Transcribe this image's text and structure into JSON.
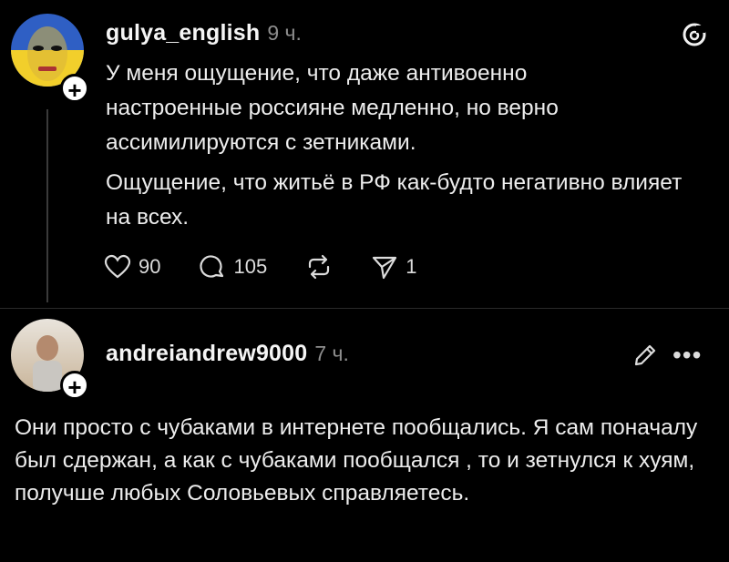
{
  "post1": {
    "username": "gulya_english",
    "time": "9 ч.",
    "paragraphs": [
      "У меня ощущение, что даже антивоенно настроенные россияне медленно, но верно ассимилируются с зетниками.",
      "Ощущение, что житьё в РФ как-будто негативно влияет на всех."
    ],
    "likes": "90",
    "replies": "105",
    "shares": "1"
  },
  "post2": {
    "username": "andreiandrew9000",
    "time": "7 ч.",
    "text": "Они просто с чубаками в интернете пообщались. Я сам поначалу был сдержан, а как с чубаками пообщался , то и зетнулся к хуям, получше любых Соловьевых справляетесь."
  },
  "icons": {
    "threads_logo": "threads-logo-icon",
    "like": "heart-icon",
    "reply": "comment-icon",
    "repost": "repost-icon",
    "share": "send-icon",
    "edit": "pencil-icon",
    "more": "more-icon",
    "follow": "plus-icon"
  }
}
